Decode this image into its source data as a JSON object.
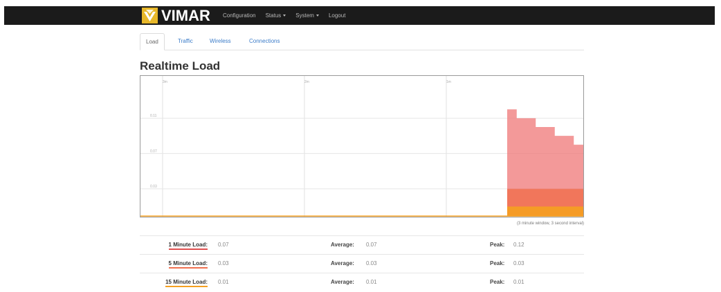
{
  "brand": {
    "name": "VIMAR",
    "logo": "vimar-logo-icon"
  },
  "nav": {
    "items": [
      {
        "label": "Configuration",
        "dropdown": false
      },
      {
        "label": "Status",
        "dropdown": true
      },
      {
        "label": "System",
        "dropdown": true
      },
      {
        "label": "Logout",
        "dropdown": false
      }
    ]
  },
  "tabs": [
    {
      "label": "Load",
      "active": true
    },
    {
      "label": "Traffic",
      "active": false
    },
    {
      "label": "Wireless",
      "active": false
    },
    {
      "label": "Connections",
      "active": false
    }
  ],
  "page": {
    "title": "Realtime Load"
  },
  "graph": {
    "time_labels": [
      "3m",
      "2m",
      "1m"
    ],
    "y_labels": [
      "0.11",
      "0.07",
      "0.03"
    ],
    "caption": "(3 minute window, 3 second interval)"
  },
  "chart_data": {
    "type": "area",
    "window": "3 minute window, 3 second interval",
    "x_ticks": [
      "3m",
      "2m",
      "1m"
    ],
    "y_ticks": [
      0.11,
      0.07,
      0.03
    ],
    "ylim": [
      0,
      0.15
    ],
    "series": [
      {
        "name": "1 Minute Load",
        "color": "#f08080",
        "x": [
          0,
          1,
          2,
          3,
          4,
          5,
          6,
          7,
          8
        ],
        "values": [
          0.12,
          0.11,
          0.11,
          0.1,
          0.1,
          0.09,
          0.09,
          0.08,
          0.08
        ]
      },
      {
        "name": "5 Minute Load",
        "color": "#f07050",
        "x": [
          0,
          8
        ],
        "values": [
          0.03,
          0.03
        ]
      },
      {
        "name": "15 Minute Load",
        "color": "#f5a020",
        "x": [
          0,
          8
        ],
        "values": [
          0.01,
          0.01
        ]
      }
    ]
  },
  "loads": [
    {
      "label": "1 Minute Load:",
      "current": "0.07",
      "avg_label": "Average:",
      "average": "0.07",
      "peak_label": "Peak:",
      "peak": "0.12",
      "color": "#e05050"
    },
    {
      "label": "5 Minute Load:",
      "current": "0.03",
      "avg_label": "Average:",
      "average": "0.03",
      "peak_label": "Peak:",
      "peak": "0.03",
      "color": "#f07050"
    },
    {
      "label": "15 Minute Load:",
      "current": "0.01",
      "avg_label": "Average:",
      "average": "0.01",
      "peak_label": "Peak:",
      "peak": "0.01",
      "color": "#f5a020"
    }
  ]
}
